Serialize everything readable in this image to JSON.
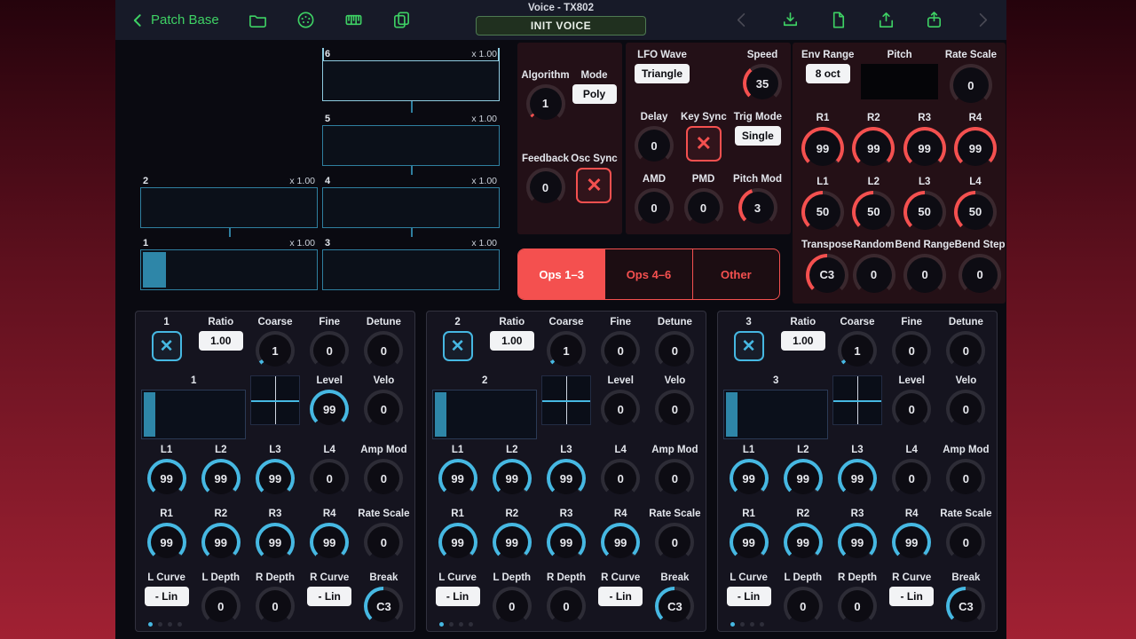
{
  "colors": {
    "green": "#3ed164",
    "red": "#f4504f",
    "cyan": "#46b8e2",
    "teal_bar": "#2e86a8"
  },
  "topbar": {
    "back_label": "Patch Base",
    "title": "Voice - TX802",
    "init_button": "INIT VOICE",
    "left_icons": [
      "folder-icon",
      "midi-icon",
      "piano-icon",
      "copy-icon"
    ],
    "right_icons": [
      {
        "name": "nav-back-icon",
        "dim": true
      },
      {
        "name": "download-icon",
        "dim": false
      },
      {
        "name": "file-icon",
        "dim": false
      },
      {
        "name": "export-icon",
        "dim": false
      },
      {
        "name": "share-icon",
        "dim": false
      },
      {
        "name": "nav-forward-icon",
        "dim": true
      }
    ]
  },
  "algorithm": {
    "blocks": [
      {
        "num": "6",
        "mult": "x 1.00",
        "col": "right",
        "row": 0,
        "selected": true,
        "filled": false
      },
      {
        "num": "5",
        "mult": "x 1.00",
        "col": "right",
        "row": 1,
        "selected": false,
        "filled": false
      },
      {
        "num": "2",
        "mult": "x 1.00",
        "col": "left",
        "row": 2,
        "selected": false,
        "filled": false
      },
      {
        "num": "4",
        "mult": "x 1.00",
        "col": "right",
        "row": 2,
        "selected": false,
        "filled": false
      },
      {
        "num": "1",
        "mult": "x 1.00",
        "col": "left",
        "row": 3,
        "selected": false,
        "filled": true
      },
      {
        "num": "3",
        "mult": "x 1.00",
        "col": "right",
        "row": 3,
        "selected": false,
        "filled": false
      }
    ]
  },
  "algo_panel": {
    "cells": [
      {
        "label": "Algorithm",
        "type": "knob",
        "value": "1",
        "pct": 0.03,
        "accent": "red"
      },
      {
        "label": "Mode",
        "type": "button",
        "value": "Poly",
        "name": "mode"
      },
      {
        "label": "Feedback",
        "type": "knob",
        "value": "0",
        "pct": 0,
        "accent": "red"
      },
      {
        "label": "Osc Sync",
        "type": "toggle",
        "name": "osc-sync"
      }
    ]
  },
  "lfo_panel": {
    "row1": [
      {
        "label": "LFO Wave",
        "type": "button",
        "value": "Triangle",
        "name": "lfo-wave"
      },
      {
        "label": "Speed",
        "type": "knob",
        "value": "35",
        "pct": 0.35,
        "accent": "red",
        "name": "lfo-speed"
      }
    ],
    "row2": [
      {
        "label": "Delay",
        "type": "knob",
        "value": "0",
        "pct": 0,
        "accent": "red",
        "name": "lfo-delay"
      },
      {
        "label": "Key Sync",
        "type": "toggle",
        "name": "lfo-key-sync"
      },
      {
        "label": "Trig Mode",
        "type": "button",
        "value": "Single",
        "name": "lfo-trig-mode"
      }
    ],
    "row3": [
      {
        "label": "AMD",
        "type": "knob",
        "value": "0",
        "pct": 0,
        "accent": "red"
      },
      {
        "label": "PMD",
        "type": "knob",
        "value": "0",
        "pct": 0,
        "accent": "red"
      },
      {
        "label": "Pitch Mod",
        "type": "knob",
        "value": "3",
        "pct": 0.43,
        "accent": "red"
      }
    ]
  },
  "pitch_panel": {
    "row0": [
      {
        "label": "Env Range",
        "type": "button",
        "value": "8 oct",
        "name": "env-range"
      },
      {
        "label": "Pitch",
        "type": "graph",
        "wide": true,
        "name": "pitch-envelope"
      },
      {
        "label": "Rate Scale",
        "type": "knob",
        "value": "0",
        "pct": 0,
        "accent": "red",
        "name": "pitch-rate-scale"
      }
    ],
    "rates": [
      {
        "label": "R1",
        "type": "knob",
        "value": "99",
        "pct": 0.99,
        "accent": "red"
      },
      {
        "label": "R2",
        "type": "knob",
        "value": "99",
        "pct": 0.99,
        "accent": "red"
      },
      {
        "label": "R3",
        "type": "knob",
        "value": "99",
        "pct": 0.99,
        "accent": "red"
      },
      {
        "label": "R4",
        "type": "knob",
        "value": "99",
        "pct": 0.99,
        "accent": "red"
      }
    ],
    "levels": [
      {
        "label": "L1",
        "type": "knob",
        "value": "50",
        "pct": 0.5,
        "accent": "red"
      },
      {
        "label": "L2",
        "type": "knob",
        "value": "50",
        "pct": 0.5,
        "accent": "red"
      },
      {
        "label": "L3",
        "type": "knob",
        "value": "50",
        "pct": 0.5,
        "accent": "red"
      },
      {
        "label": "L4",
        "type": "knob",
        "value": "50",
        "pct": 0.5,
        "accent": "red"
      }
    ],
    "row3": [
      {
        "label": "Transpose",
        "type": "knob",
        "value": "C3",
        "pct": 0.5,
        "accent": "red"
      },
      {
        "label": "Random",
        "type": "knob",
        "value": "0",
        "pct": 0,
        "accent": "red"
      },
      {
        "label": "Bend Range",
        "type": "knob",
        "value": "0",
        "pct": 0,
        "accent": "red"
      },
      {
        "label": "Bend Step",
        "type": "knob",
        "value": "0",
        "pct": 0,
        "accent": "red"
      }
    ]
  },
  "tabs": {
    "items": [
      {
        "label": "Ops 1–3",
        "active": true
      },
      {
        "label": "Ops 4–6",
        "active": false
      },
      {
        "label": "Other",
        "active": false
      }
    ]
  },
  "operators": [
    {
      "num": "1",
      "dots": 4,
      "active_dot": 0,
      "row1": [
        {
          "label": "1",
          "type": "check",
          "name": "op-1-enable"
        },
        {
          "label": "Ratio",
          "type": "button",
          "value": "1.00",
          "name": "op-1-ratio"
        },
        {
          "label": "Coarse",
          "type": "knob",
          "value": "1",
          "pct": 0.04,
          "accent": "cyan"
        },
        {
          "label": "Fine",
          "type": "knob",
          "value": "0",
          "pct": 0
        },
        {
          "label": "Detune",
          "type": "knob",
          "value": "0",
          "pct": 0
        }
      ],
      "row2": [
        {
          "type": "env",
          "label": "1",
          "span2": true,
          "name": "op-1-envelope"
        },
        {
          "type": "scaling",
          "name": "op-1-key-scaling"
        },
        {
          "label": "Level",
          "type": "knob",
          "value": "99",
          "pct": 0.99,
          "accent": "cyan"
        },
        {
          "label": "Velo",
          "type": "knob",
          "value": "0",
          "pct": 0
        }
      ],
      "row3": [
        {
          "label": "L1",
          "type": "knob",
          "value": "99",
          "pct": 0.99,
          "accent": "cyan"
        },
        {
          "label": "L2",
          "type": "knob",
          "value": "99",
          "pct": 0.99,
          "accent": "cyan"
        },
        {
          "label": "L3",
          "type": "knob",
          "value": "99",
          "pct": 0.99,
          "accent": "cyan"
        },
        {
          "label": "L4",
          "type": "knob",
          "value": "0",
          "pct": 0
        },
        {
          "label": "Amp Mod",
          "type": "knob",
          "value": "0",
          "pct": 0
        }
      ],
      "row4": [
        {
          "label": "R1",
          "type": "knob",
          "value": "99",
          "pct": 0.99,
          "accent": "cyan"
        },
        {
          "label": "R2",
          "type": "knob",
          "value": "99",
          "pct": 0.99,
          "accent": "cyan"
        },
        {
          "label": "R3",
          "type": "knob",
          "value": "99",
          "pct": 0.99,
          "accent": "cyan"
        },
        {
          "label": "R4",
          "type": "knob",
          "value": "99",
          "pct": 0.99,
          "accent": "cyan"
        },
        {
          "label": "Rate Scale",
          "type": "knob",
          "value": "0",
          "pct": 0
        }
      ],
      "row5": [
        {
          "label": "L Curve",
          "type": "button",
          "value": "- Lin"
        },
        {
          "label": "L Depth",
          "type": "knob",
          "value": "0",
          "pct": 0
        },
        {
          "label": "R Depth",
          "type": "knob",
          "value": "0",
          "pct": 0
        },
        {
          "label": "R Curve",
          "type": "button",
          "value": "- Lin"
        },
        {
          "label": "Break",
          "type": "knob",
          "value": "C3",
          "pct": 0.5,
          "accent": "cyan"
        }
      ]
    },
    {
      "num": "2",
      "dots": 4,
      "active_dot": 0,
      "row1": [
        {
          "label": "2",
          "type": "check",
          "name": "op-2-enable"
        },
        {
          "label": "Ratio",
          "type": "button",
          "value": "1.00",
          "name": "op-2-ratio"
        },
        {
          "label": "Coarse",
          "type": "knob",
          "value": "1",
          "pct": 0.04,
          "accent": "cyan"
        },
        {
          "label": "Fine",
          "type": "knob",
          "value": "0",
          "pct": 0
        },
        {
          "label": "Detune",
          "type": "knob",
          "value": "0",
          "pct": 0
        }
      ],
      "row2": [
        {
          "type": "env",
          "label": "2",
          "span2": true,
          "name": "op-2-envelope"
        },
        {
          "type": "scaling",
          "name": "op-2-key-scaling"
        },
        {
          "label": "Level",
          "type": "knob",
          "value": "0",
          "pct": 0
        },
        {
          "label": "Velo",
          "type": "knob",
          "value": "0",
          "pct": 0
        }
      ],
      "row3": [
        {
          "label": "L1",
          "type": "knob",
          "value": "99",
          "pct": 0.99,
          "accent": "cyan"
        },
        {
          "label": "L2",
          "type": "knob",
          "value": "99",
          "pct": 0.99,
          "accent": "cyan"
        },
        {
          "label": "L3",
          "type": "knob",
          "value": "99",
          "pct": 0.99,
          "accent": "cyan"
        },
        {
          "label": "L4",
          "type": "knob",
          "value": "0",
          "pct": 0
        },
        {
          "label": "Amp Mod",
          "type": "knob",
          "value": "0",
          "pct": 0
        }
      ],
      "row4": [
        {
          "label": "R1",
          "type": "knob",
          "value": "99",
          "pct": 0.99,
          "accent": "cyan"
        },
        {
          "label": "R2",
          "type": "knob",
          "value": "99",
          "pct": 0.99,
          "accent": "cyan"
        },
        {
          "label": "R3",
          "type": "knob",
          "value": "99",
          "pct": 0.99,
          "accent": "cyan"
        },
        {
          "label": "R4",
          "type": "knob",
          "value": "99",
          "pct": 0.99,
          "accent": "cyan"
        },
        {
          "label": "Rate Scale",
          "type": "knob",
          "value": "0",
          "pct": 0
        }
      ],
      "row5": [
        {
          "label": "L Curve",
          "type": "button",
          "value": "- Lin"
        },
        {
          "label": "L Depth",
          "type": "knob",
          "value": "0",
          "pct": 0
        },
        {
          "label": "R Depth",
          "type": "knob",
          "value": "0",
          "pct": 0
        },
        {
          "label": "R Curve",
          "type": "button",
          "value": "- Lin"
        },
        {
          "label": "Break",
          "type": "knob",
          "value": "C3",
          "pct": 0.5,
          "accent": "cyan"
        }
      ]
    },
    {
      "num": "3",
      "dots": 4,
      "active_dot": 0,
      "row1": [
        {
          "label": "3",
          "type": "check",
          "name": "op-3-enable"
        },
        {
          "label": "Ratio",
          "type": "button",
          "value": "1.00",
          "name": "op-3-ratio"
        },
        {
          "label": "Coarse",
          "type": "knob",
          "value": "1",
          "pct": 0.04,
          "accent": "cyan"
        },
        {
          "label": "Fine",
          "type": "knob",
          "value": "0",
          "pct": 0
        },
        {
          "label": "Detune",
          "type": "knob",
          "value": "0",
          "pct": 0
        }
      ],
      "row2": [
        {
          "type": "env",
          "label": "3",
          "span2": true,
          "name": "op-3-envelope"
        },
        {
          "type": "scaling",
          "name": "op-3-key-scaling"
        },
        {
          "label": "Level",
          "type": "knob",
          "value": "0",
          "pct": 0
        },
        {
          "label": "Velo",
          "type": "knob",
          "value": "0",
          "pct": 0
        }
      ],
      "row3": [
        {
          "label": "L1",
          "type": "knob",
          "value": "99",
          "pct": 0.99,
          "accent": "cyan"
        },
        {
          "label": "L2",
          "type": "knob",
          "value": "99",
          "pct": 0.99,
          "accent": "cyan"
        },
        {
          "label": "L3",
          "type": "knob",
          "value": "99",
          "pct": 0.99,
          "accent": "cyan"
        },
        {
          "label": "L4",
          "type": "knob",
          "value": "0",
          "pct": 0
        },
        {
          "label": "Amp Mod",
          "type": "knob",
          "value": "0",
          "pct": 0
        }
      ],
      "row4": [
        {
          "label": "R1",
          "type": "knob",
          "value": "99",
          "pct": 0.99,
          "accent": "cyan"
        },
        {
          "label": "R2",
          "type": "knob",
          "value": "99",
          "pct": 0.99,
          "accent": "cyan"
        },
        {
          "label": "R3",
          "type": "knob",
          "value": "99",
          "pct": 0.99,
          "accent": "cyan"
        },
        {
          "label": "R4",
          "type": "knob",
          "value": "99",
          "pct": 0.99,
          "accent": "cyan"
        },
        {
          "label": "Rate Scale",
          "type": "knob",
          "value": "0",
          "pct": 0
        }
      ],
      "row5": [
        {
          "label": "L Curve",
          "type": "button",
          "value": "- Lin"
        },
        {
          "label": "L Depth",
          "type": "knob",
          "value": "0",
          "pct": 0
        },
        {
          "label": "R Depth",
          "type": "knob",
          "value": "0",
          "pct": 0
        },
        {
          "label": "R Curve",
          "type": "button",
          "value": "- Lin"
        },
        {
          "label": "Break",
          "type": "knob",
          "value": "C3",
          "pct": 0.5,
          "accent": "cyan"
        }
      ]
    }
  ]
}
